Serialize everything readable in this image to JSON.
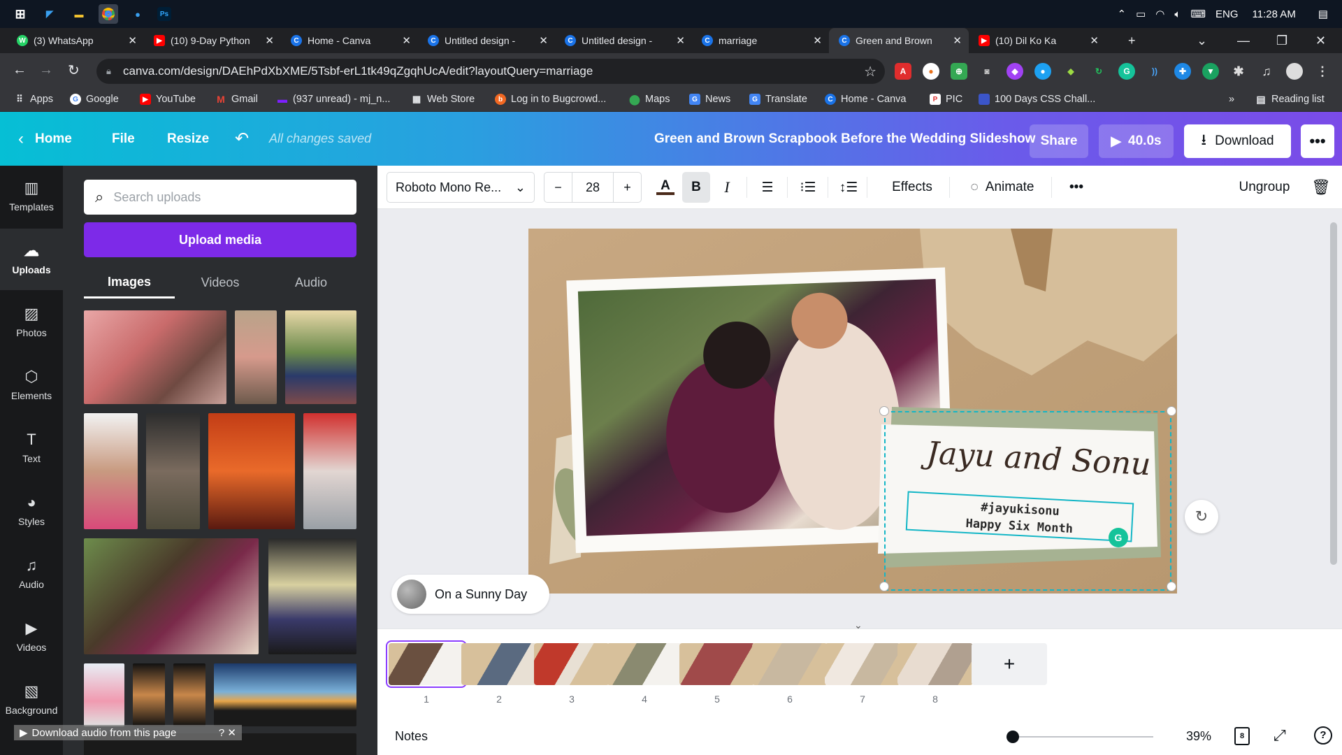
{
  "taskbar": {
    "lang": "ENG",
    "time": "11:28 AM"
  },
  "tabs": [
    {
      "title": "(3) WhatsApp",
      "fav": "wa",
      "favtext": "W"
    },
    {
      "title": "(10) 9-Day Python",
      "fav": "yt",
      "favtext": "▶"
    },
    {
      "title": "Home - Canva",
      "fav": "cv",
      "favtext": "C"
    },
    {
      "title": "Untitled design -",
      "fav": "cv",
      "favtext": "C"
    },
    {
      "title": "Untitled design -",
      "fav": "cv",
      "favtext": "C"
    },
    {
      "title": "marriage",
      "fav": "cv",
      "favtext": "C"
    },
    {
      "title": "Green and Brown",
      "fav": "cv",
      "favtext": "C"
    },
    {
      "title": "(10) Dil Ko Ka",
      "fav": "yt",
      "favtext": "▶"
    }
  ],
  "address": {
    "url": "canva.com/design/DAEhPdXbXME/5Tsbf-erL1tk49qZgqhUcA/edit?layoutQuery=marriage"
  },
  "bookmarks": [
    "Apps",
    "Google",
    "YouTube",
    "Gmail",
    "(937 unread) - mj_n...",
    "Web Store",
    "Log in to Bugcrowd...",
    "Maps",
    "News",
    "Translate",
    "Home - Canva",
    "PIC",
    "100 Days CSS Chall...",
    "Reading list"
  ],
  "header": {
    "home": "Home",
    "file": "File",
    "resize": "Resize",
    "saved": "All changes saved",
    "title": "Green and Brown Scrapbook Before the Wedding Slideshow",
    "share": "Share",
    "duration": "40.0s",
    "download": "Download"
  },
  "rail": [
    "Templates",
    "Uploads",
    "Photos",
    "Elements",
    "Text",
    "Styles",
    "Audio",
    "Videos",
    "Background"
  ],
  "panel": {
    "search_placeholder": "Search uploads",
    "upload": "Upload media",
    "tabs": [
      "Images",
      "Videos",
      "Audio"
    ],
    "audio_hint": "Download audio from this page"
  },
  "toolbar": {
    "font": "Roboto Mono Re...",
    "size": "28",
    "effects": "Effects",
    "animate": "Animate",
    "ungroup": "Ungroup"
  },
  "canvas": {
    "script_text": "Jayu and Sonu",
    "hashtag": "#jayukisonu",
    "subtitle": "Happy Six Month",
    "audio_track": "On a Sunny Day"
  },
  "timeline": {
    "pages": [
      "1",
      "2",
      "3",
      "4",
      "5",
      "6",
      "7",
      "8"
    ]
  },
  "footer": {
    "notes": "Notes",
    "zoom": "39%",
    "page_count": "8"
  }
}
